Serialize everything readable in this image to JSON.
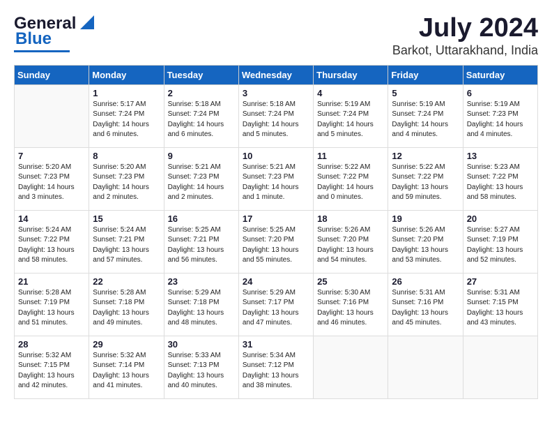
{
  "header": {
    "logo_general": "General",
    "logo_blue": "Blue",
    "month": "July 2024",
    "location": "Barkot, Uttarakhand, India"
  },
  "days_of_week": [
    "Sunday",
    "Monday",
    "Tuesday",
    "Wednesday",
    "Thursday",
    "Friday",
    "Saturday"
  ],
  "weeks": [
    [
      {
        "day": "",
        "info": ""
      },
      {
        "day": "1",
        "info": "Sunrise: 5:17 AM\nSunset: 7:24 PM\nDaylight: 14 hours\nand 6 minutes."
      },
      {
        "day": "2",
        "info": "Sunrise: 5:18 AM\nSunset: 7:24 PM\nDaylight: 14 hours\nand 6 minutes."
      },
      {
        "day": "3",
        "info": "Sunrise: 5:18 AM\nSunset: 7:24 PM\nDaylight: 14 hours\nand 5 minutes."
      },
      {
        "day": "4",
        "info": "Sunrise: 5:19 AM\nSunset: 7:24 PM\nDaylight: 14 hours\nand 5 minutes."
      },
      {
        "day": "5",
        "info": "Sunrise: 5:19 AM\nSunset: 7:24 PM\nDaylight: 14 hours\nand 4 minutes."
      },
      {
        "day": "6",
        "info": "Sunrise: 5:19 AM\nSunset: 7:23 PM\nDaylight: 14 hours\nand 4 minutes."
      }
    ],
    [
      {
        "day": "7",
        "info": "Sunrise: 5:20 AM\nSunset: 7:23 PM\nDaylight: 14 hours\nand 3 minutes."
      },
      {
        "day": "8",
        "info": "Sunrise: 5:20 AM\nSunset: 7:23 PM\nDaylight: 14 hours\nand 2 minutes."
      },
      {
        "day": "9",
        "info": "Sunrise: 5:21 AM\nSunset: 7:23 PM\nDaylight: 14 hours\nand 2 minutes."
      },
      {
        "day": "10",
        "info": "Sunrise: 5:21 AM\nSunset: 7:23 PM\nDaylight: 14 hours\nand 1 minute."
      },
      {
        "day": "11",
        "info": "Sunrise: 5:22 AM\nSunset: 7:22 PM\nDaylight: 14 hours\nand 0 minutes."
      },
      {
        "day": "12",
        "info": "Sunrise: 5:22 AM\nSunset: 7:22 PM\nDaylight: 13 hours\nand 59 minutes."
      },
      {
        "day": "13",
        "info": "Sunrise: 5:23 AM\nSunset: 7:22 PM\nDaylight: 13 hours\nand 58 minutes."
      }
    ],
    [
      {
        "day": "14",
        "info": "Sunrise: 5:24 AM\nSunset: 7:22 PM\nDaylight: 13 hours\nand 58 minutes."
      },
      {
        "day": "15",
        "info": "Sunrise: 5:24 AM\nSunset: 7:21 PM\nDaylight: 13 hours\nand 57 minutes."
      },
      {
        "day": "16",
        "info": "Sunrise: 5:25 AM\nSunset: 7:21 PM\nDaylight: 13 hours\nand 56 minutes."
      },
      {
        "day": "17",
        "info": "Sunrise: 5:25 AM\nSunset: 7:20 PM\nDaylight: 13 hours\nand 55 minutes."
      },
      {
        "day": "18",
        "info": "Sunrise: 5:26 AM\nSunset: 7:20 PM\nDaylight: 13 hours\nand 54 minutes."
      },
      {
        "day": "19",
        "info": "Sunrise: 5:26 AM\nSunset: 7:20 PM\nDaylight: 13 hours\nand 53 minutes."
      },
      {
        "day": "20",
        "info": "Sunrise: 5:27 AM\nSunset: 7:19 PM\nDaylight: 13 hours\nand 52 minutes."
      }
    ],
    [
      {
        "day": "21",
        "info": "Sunrise: 5:28 AM\nSunset: 7:19 PM\nDaylight: 13 hours\nand 51 minutes."
      },
      {
        "day": "22",
        "info": "Sunrise: 5:28 AM\nSunset: 7:18 PM\nDaylight: 13 hours\nand 49 minutes."
      },
      {
        "day": "23",
        "info": "Sunrise: 5:29 AM\nSunset: 7:18 PM\nDaylight: 13 hours\nand 48 minutes."
      },
      {
        "day": "24",
        "info": "Sunrise: 5:29 AM\nSunset: 7:17 PM\nDaylight: 13 hours\nand 47 minutes."
      },
      {
        "day": "25",
        "info": "Sunrise: 5:30 AM\nSunset: 7:16 PM\nDaylight: 13 hours\nand 46 minutes."
      },
      {
        "day": "26",
        "info": "Sunrise: 5:31 AM\nSunset: 7:16 PM\nDaylight: 13 hours\nand 45 minutes."
      },
      {
        "day": "27",
        "info": "Sunrise: 5:31 AM\nSunset: 7:15 PM\nDaylight: 13 hours\nand 43 minutes."
      }
    ],
    [
      {
        "day": "28",
        "info": "Sunrise: 5:32 AM\nSunset: 7:15 PM\nDaylight: 13 hours\nand 42 minutes."
      },
      {
        "day": "29",
        "info": "Sunrise: 5:32 AM\nSunset: 7:14 PM\nDaylight: 13 hours\nand 41 minutes."
      },
      {
        "day": "30",
        "info": "Sunrise: 5:33 AM\nSunset: 7:13 PM\nDaylight: 13 hours\nand 40 minutes."
      },
      {
        "day": "31",
        "info": "Sunrise: 5:34 AM\nSunset: 7:12 PM\nDaylight: 13 hours\nand 38 minutes."
      },
      {
        "day": "",
        "info": ""
      },
      {
        "day": "",
        "info": ""
      },
      {
        "day": "",
        "info": ""
      }
    ]
  ]
}
